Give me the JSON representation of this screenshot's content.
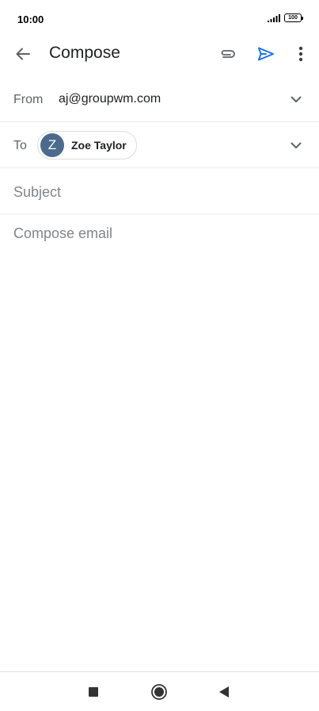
{
  "status": {
    "time": "10:00",
    "battery": "100"
  },
  "app_bar": {
    "title": "Compose"
  },
  "from": {
    "label": "From",
    "value": "aj@groupwm.com"
  },
  "to": {
    "label": "To",
    "recipient": {
      "initial": "Z",
      "name": "Zoe Taylor",
      "avatar_color": "#4a6b8c"
    }
  },
  "subject": {
    "placeholder": "Subject",
    "value": ""
  },
  "body": {
    "placeholder": "Compose email",
    "value": ""
  },
  "colors": {
    "accent": "#1a73e8",
    "icon": "#5f6368"
  },
  "icons": [
    "back-arrow-icon",
    "paperclip-icon",
    "send-icon",
    "more-vert-icon",
    "chevron-down-icon",
    "signal-icon",
    "battery-icon",
    "recents-icon",
    "home-icon",
    "back-triangle-icon"
  ]
}
